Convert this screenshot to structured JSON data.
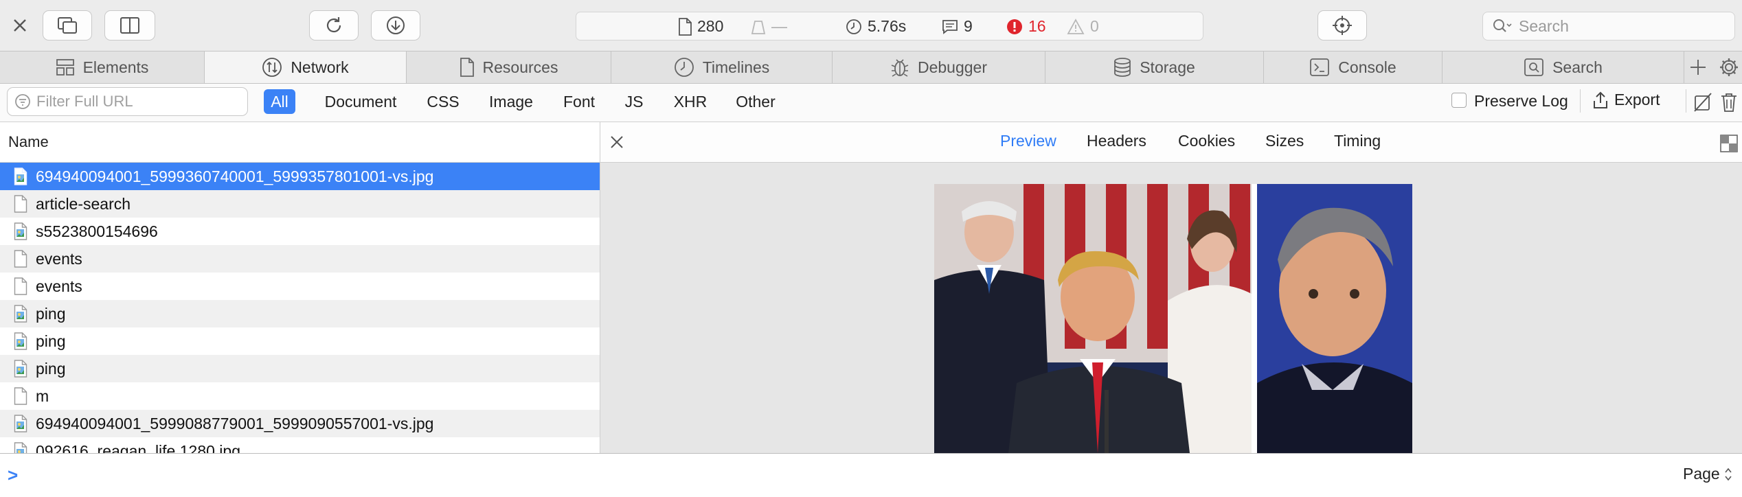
{
  "toolbar": {
    "resources_count": "280",
    "transfer_size": "—",
    "load_time": "5.76s",
    "logs_count": "9",
    "errors_count": "16",
    "warnings_count": "0",
    "search_placeholder": "Search"
  },
  "tabs": [
    {
      "label": "Elements",
      "icon": "elements-icon"
    },
    {
      "label": "Network",
      "icon": "network-icon"
    },
    {
      "label": "Resources",
      "icon": "resources-icon"
    },
    {
      "label": "Timelines",
      "icon": "timelines-icon"
    },
    {
      "label": "Debugger",
      "icon": "debugger-icon"
    },
    {
      "label": "Storage",
      "icon": "storage-icon"
    },
    {
      "label": "Console",
      "icon": "console-icon"
    },
    {
      "label": "Search",
      "icon": "search-tab-icon"
    }
  ],
  "active_tab": "Network",
  "filter": {
    "placeholder": "Filter Full URL",
    "types": [
      "All",
      "Document",
      "CSS",
      "Image",
      "Font",
      "JS",
      "XHR",
      "Other"
    ],
    "active_type": "All",
    "preserve_log_label": "Preserve Log",
    "preserve_log_checked": false,
    "export_label": "Export"
  },
  "list": {
    "header": "Name",
    "rows": [
      {
        "name": "694940094001_5999360740001_5999357801001-vs.jpg",
        "kind": "image",
        "selected": true
      },
      {
        "name": "article-search",
        "kind": "document"
      },
      {
        "name": "s5523800154696",
        "kind": "image"
      },
      {
        "name": "events",
        "kind": "document"
      },
      {
        "name": "events",
        "kind": "document"
      },
      {
        "name": "ping",
        "kind": "image"
      },
      {
        "name": "ping",
        "kind": "image"
      },
      {
        "name": "ping",
        "kind": "image"
      },
      {
        "name": "m",
        "kind": "document"
      },
      {
        "name": "694940094001_5999088779001_5999090557001-vs.jpg",
        "kind": "image"
      },
      {
        "name": "092616_reagan_life 1280.jpg",
        "kind": "image"
      }
    ]
  },
  "details": {
    "tabs": [
      "Preview",
      "Headers",
      "Cookies",
      "Sizes",
      "Timing"
    ],
    "active_tab": "Preview"
  },
  "console": {
    "prompt": ">",
    "context_label": "Page"
  },
  "colors": {
    "accent": "#3b82f6",
    "error": "#e0252d",
    "preview_tab": "#2f7cf6"
  }
}
